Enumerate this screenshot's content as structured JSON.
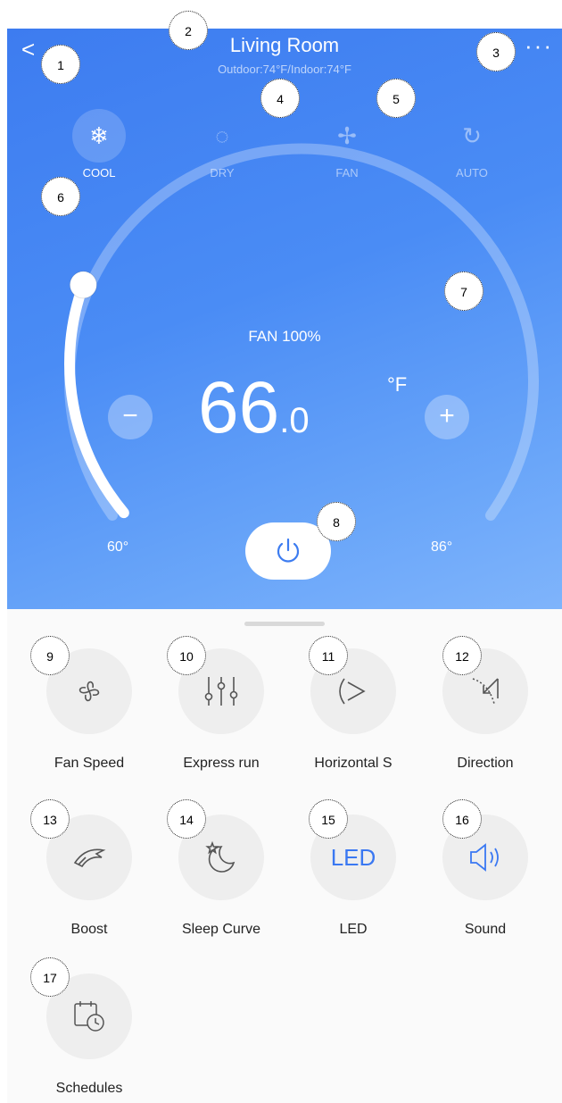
{
  "header": {
    "back_icon": "chevron-left-icon",
    "title": "Living Room",
    "subtitle": "Outdoor:74°F/Indoor:74°F",
    "more_label": "···"
  },
  "modes": [
    {
      "label": "COOL",
      "icon": "snowflake-icon",
      "glyph": "❄",
      "active": true
    },
    {
      "label": "DRY",
      "icon": "droplet-icon",
      "glyph": "◌",
      "active": false
    },
    {
      "label": "FAN",
      "icon": "fan-icon",
      "glyph": "✢",
      "active": false
    },
    {
      "label": "AUTO",
      "icon": "auto-cycle-icon",
      "glyph": "↻",
      "active": false
    }
  ],
  "thermostat": {
    "fan_text": "FAN 100%",
    "temp_whole": "66",
    "temp_decimal": ".0",
    "unit": "°F",
    "minus": "−",
    "plus": "+",
    "min_label": "60°",
    "max_label": "86°",
    "setpoint_fraction": 0.23
  },
  "features": [
    {
      "label": "Fan Speed",
      "icon": "fan-speed-icon"
    },
    {
      "label": "Express run",
      "icon": "sliders-icon"
    },
    {
      "label": "Horizontal S",
      "icon": "horizontal-swing-icon"
    },
    {
      "label": "Direction",
      "icon": "direction-icon"
    },
    {
      "label": "Boost",
      "icon": "boost-icon"
    },
    {
      "label": "Sleep Curve",
      "icon": "sleep-curve-icon"
    },
    {
      "label": "LED",
      "icon": "led-icon",
      "text": "LED"
    },
    {
      "label": "Sound",
      "icon": "sound-icon"
    },
    {
      "label": "Schedules",
      "icon": "schedule-icon"
    }
  ],
  "callouts": [
    "1",
    "2",
    "3",
    "4",
    "5",
    "6",
    "7",
    "8",
    "9",
    "10",
    "11",
    "12",
    "13",
    "14",
    "15",
    "16",
    "17"
  ],
  "colors": {
    "accent": "#3d7cf0",
    "led_blue": "#3a78f2"
  }
}
